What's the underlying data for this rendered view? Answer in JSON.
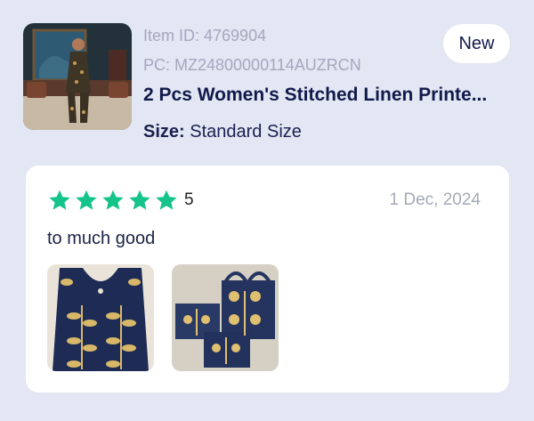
{
  "product": {
    "item_id": "Item ID: 4769904",
    "pc": "PC: MZ24800000114AUZRCN",
    "title": "2 Pcs Women's Stitched Linen Printe...",
    "size_label": "Size:",
    "size_value": "Standard Size",
    "badge": "New",
    "thumbnail_icon": "product-photo"
  },
  "review": {
    "rating": 5,
    "rating_text": "5",
    "date": "1 Dec, 2024",
    "text": "to much good",
    "photos": [
      "review-photo-1",
      "review-photo-2"
    ]
  },
  "colors": {
    "background": "#e3e6f3",
    "star": "#14c48a",
    "title": "#111a4a",
    "muted": "#a3a8bd"
  }
}
